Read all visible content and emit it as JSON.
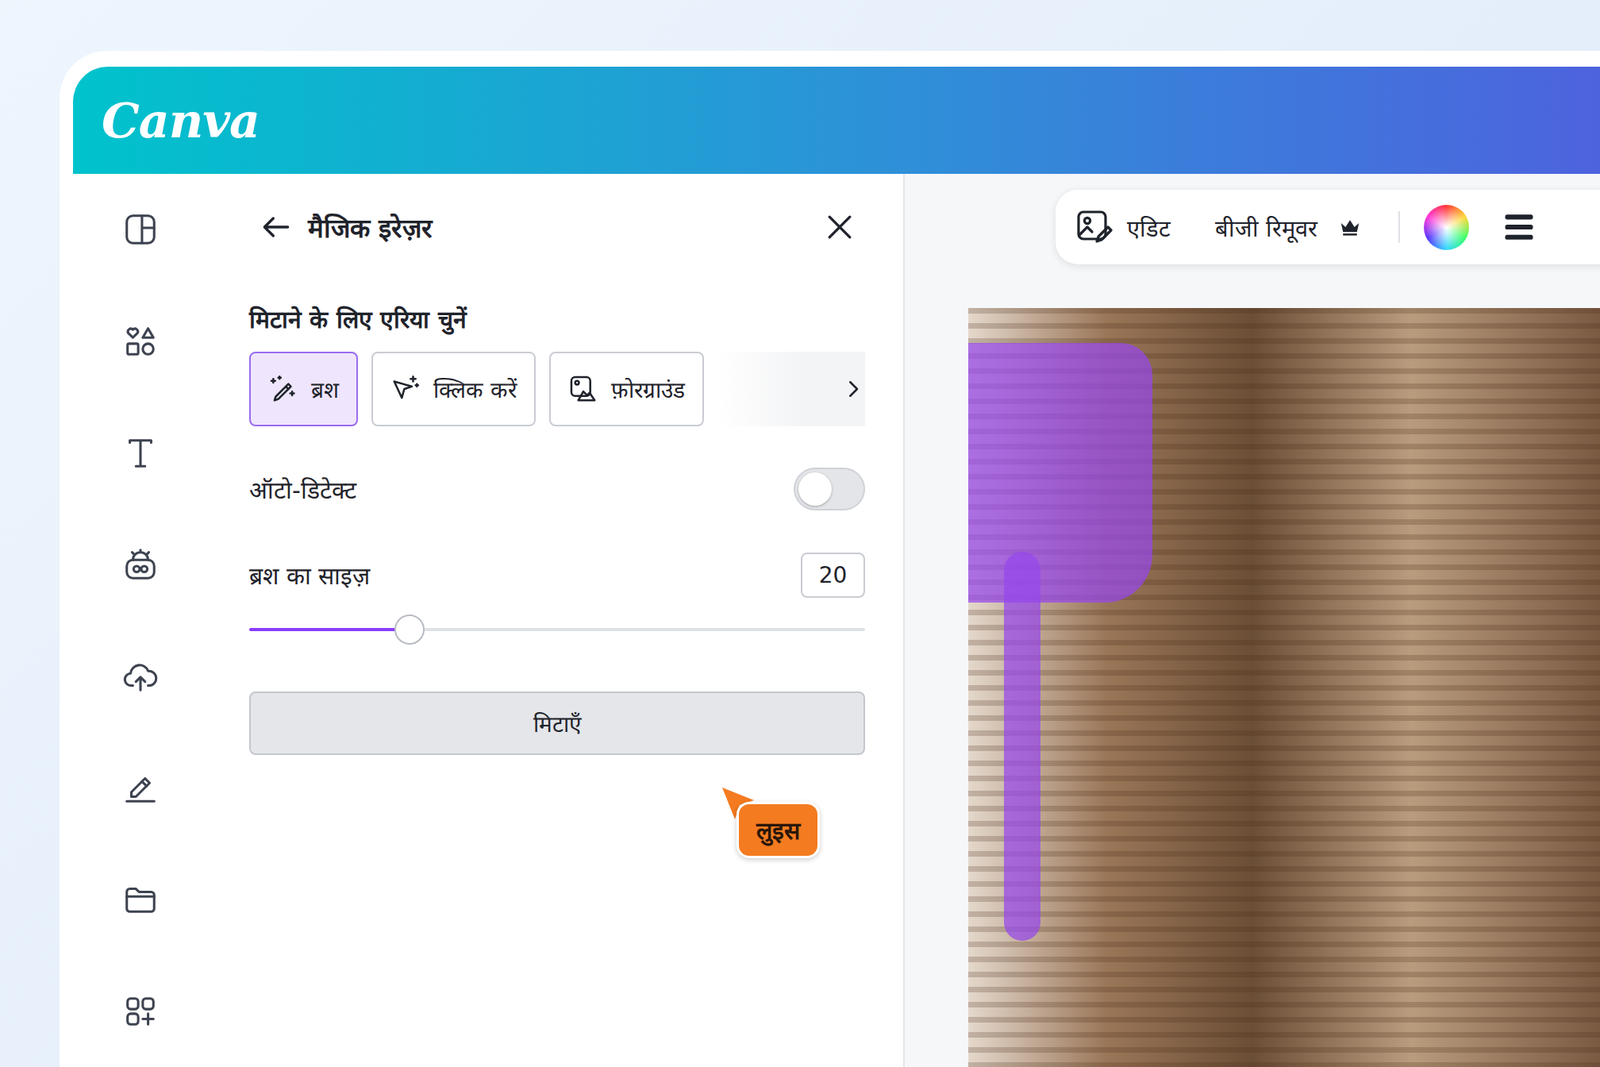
{
  "logo": "Canva",
  "panel": {
    "title": "मैजिक इरेज़र",
    "section_label": "मिटाने के लिए एरिया चुनें",
    "modes": [
      {
        "label": "ब्रश",
        "selected": true
      },
      {
        "label": "क्लिक करें",
        "selected": false
      },
      {
        "label": "फ़ोरग्राउंड",
        "selected": false
      }
    ],
    "auto_detect": {
      "label": "ऑटो-डिटेक्ट",
      "on": false
    },
    "brush_size": {
      "label": "ब्रश का साइज़",
      "value": "20",
      "level": 0.26
    },
    "erase_button": "मिटाएँ"
  },
  "cursor": {
    "name": "लुइस",
    "color": "#f47b20"
  },
  "toolbar": {
    "edit": "एडिट",
    "bg_remover": "बीजी रिमूवर"
  }
}
